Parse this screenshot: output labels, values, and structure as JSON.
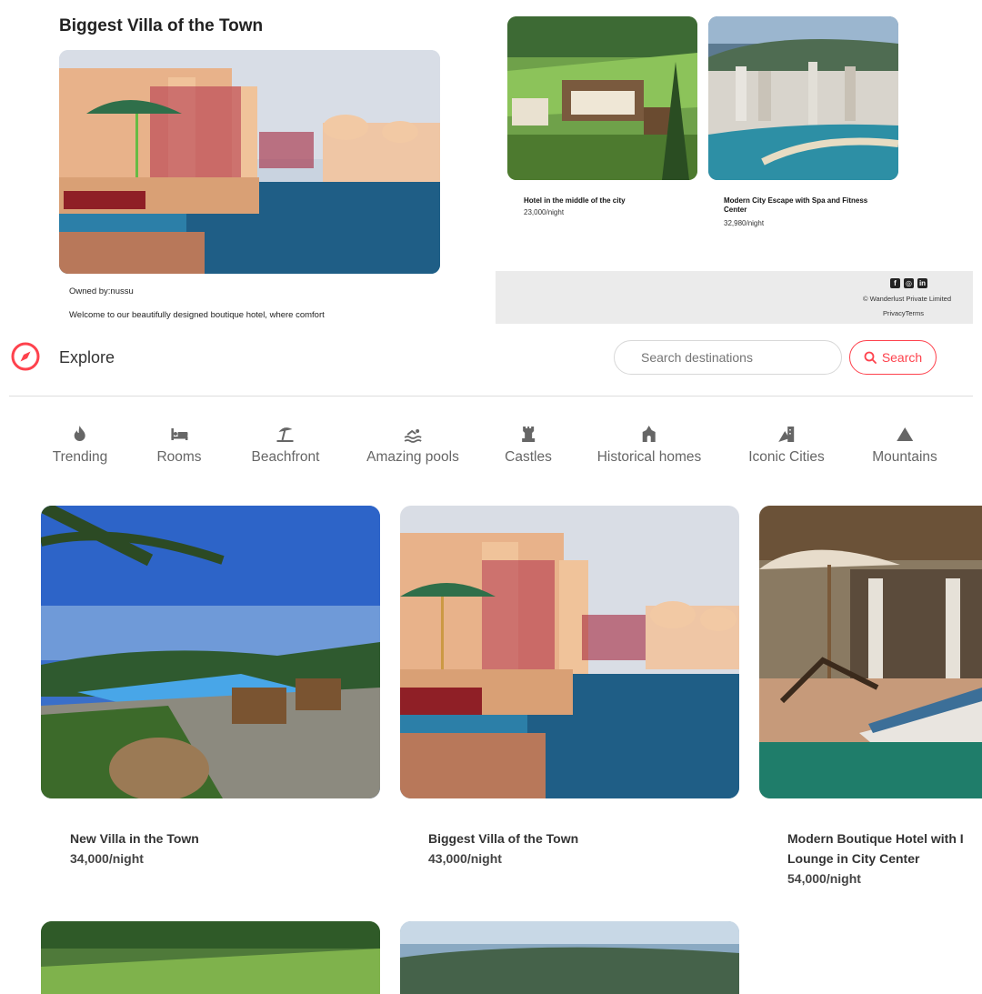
{
  "detail": {
    "title": "Biggest Villa of the Town",
    "owner": "Owned by:nussu",
    "description": "Welcome to our beautifully designed boutique hotel, where comfort"
  },
  "mini_cards": [
    {
      "title": "Hotel in the middle of the city",
      "price": "23,000/night"
    },
    {
      "title": "Modern City Escape with Spa and Fitness Center",
      "price": "32,980/night"
    }
  ],
  "footer": {
    "icons": [
      "facebook-icon",
      "instagram-icon",
      "linkedin-icon"
    ],
    "copyright": "© Wanderlust Private Limited",
    "links": "PrivacyTerms"
  },
  "navbar": {
    "brand": "Explore",
    "search_placeholder": "Search destinations",
    "search_label": "Search",
    "accent": "#fe424d"
  },
  "filters": [
    {
      "label": "Trending",
      "icon": "fire-icon"
    },
    {
      "label": "Rooms",
      "icon": "bed-icon"
    },
    {
      "label": "Beachfront",
      "icon": "umbrella-beach-icon"
    },
    {
      "label": "Amazing pools",
      "icon": "swimmer-icon"
    },
    {
      "label": "Castles",
      "icon": "chess-rook-icon"
    },
    {
      "label": "Historical homes",
      "icon": "archway-icon"
    },
    {
      "label": "Iconic Cities",
      "icon": "city-icon"
    },
    {
      "label": "Mountains",
      "icon": "mountain-icon"
    }
  ],
  "listings": [
    {
      "title": "New Villa in the Town",
      "price": "34,000/night"
    },
    {
      "title": "Biggest Villa of the Town",
      "price": "43,000/night"
    },
    {
      "title": "Modern Boutique Hotel with I",
      "title2": "Lounge in City Center",
      "price": "54,000/night"
    }
  ]
}
